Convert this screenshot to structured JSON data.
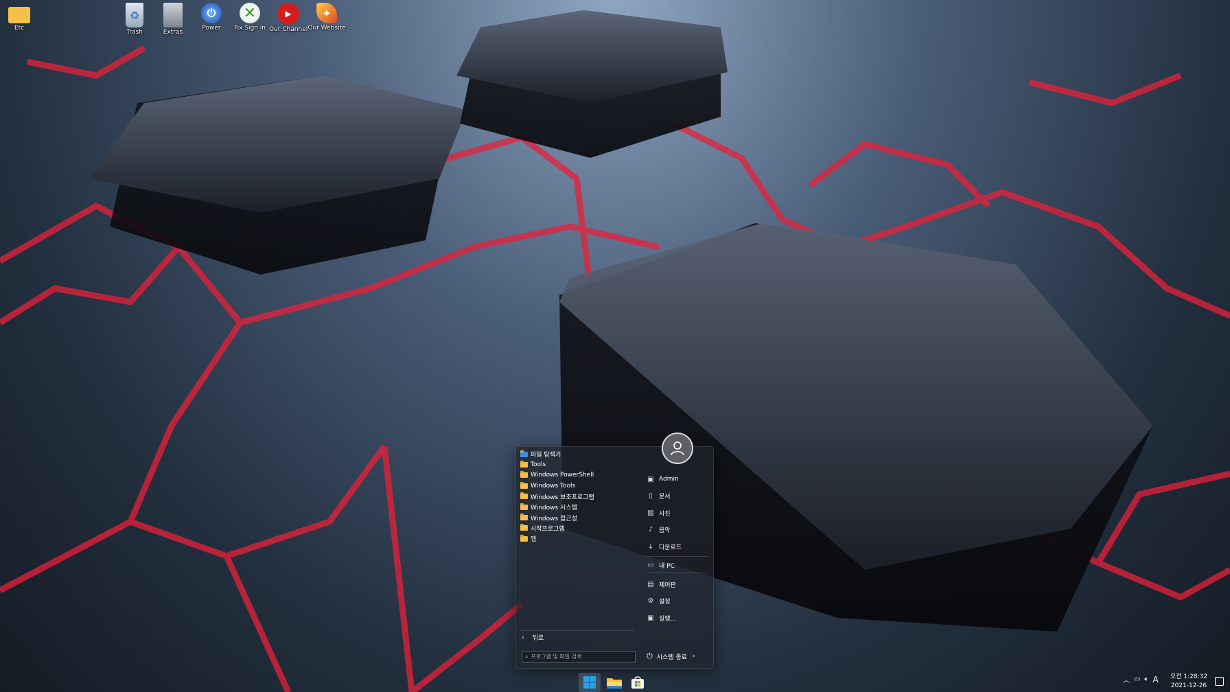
{
  "desktop": {
    "icons": [
      {
        "label": "Etc",
        "icon": "folder-icon"
      },
      {
        "label": "Trash",
        "icon": "recycle-bin-icon"
      },
      {
        "label": "Extras",
        "icon": "extras-cabinet-icon"
      },
      {
        "label": "Power",
        "icon": "power-settings-icon"
      },
      {
        "label": "Fix Sign in",
        "icon": "xbox-icon"
      },
      {
        "label": "Our Channel",
        "icon": "youtube-icon"
      },
      {
        "label": "Our Website",
        "icon": "phoenix-icon"
      }
    ]
  },
  "start_menu": {
    "folders": [
      {
        "label": "파일 탐색기"
      },
      {
        "label": "Tools"
      },
      {
        "label": "Windows PowerShell"
      },
      {
        "label": "Windows Tools"
      },
      {
        "label": "Windows 보조프로그램"
      },
      {
        "label": "Windows 시스템"
      },
      {
        "label": "Windows 접근성"
      },
      {
        "label": "시작프로그램"
      },
      {
        "label": "앱"
      }
    ],
    "places": [
      {
        "label": "Admin",
        "icon": "user-folder-icon"
      },
      {
        "label": "문서",
        "icon": "document-icon"
      },
      {
        "label": "사진",
        "icon": "picture-icon"
      },
      {
        "label": "음악",
        "icon": "music-icon"
      },
      {
        "label": "다운로드",
        "icon": "download-icon"
      },
      {
        "label": "내 PC",
        "icon": "computer-icon"
      },
      {
        "label": "제어판",
        "icon": "control-panel-icon"
      },
      {
        "label": "설정",
        "icon": "gear-icon"
      },
      {
        "label": "실행...",
        "icon": "run-icon"
      }
    ],
    "back_label": "뒤로",
    "search_placeholder": "프로그램 및 파일 검색",
    "power_label": "시스템 종료"
  },
  "taskbar": {
    "apps": [
      {
        "name": "start-button",
        "icon": "windows-logo-icon"
      },
      {
        "name": "file-explorer",
        "icon": "file-explorer-icon"
      },
      {
        "name": "store",
        "icon": "store-icon"
      }
    ],
    "tray_lang": "A",
    "clock_time": "오전 1:28:32",
    "clock_date": "2021-12-26"
  },
  "colors": {
    "accent_red": "#e8203a",
    "folder_yellow": "#f4c04a",
    "windows_blue": "#1fa3f0"
  }
}
